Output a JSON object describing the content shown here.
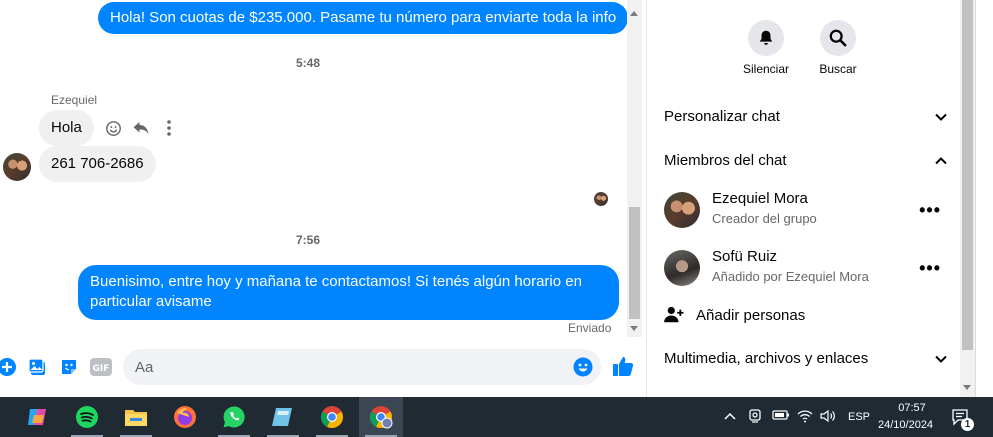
{
  "chat": {
    "top_message": "Hola! Son cuotas de $235.000. Pasame tu número para enviarte toda la info",
    "time_1": "5:48",
    "sender_name": "Ezequiel",
    "incoming": [
      "Hola",
      "261 706-2686"
    ],
    "time_2": "7:56",
    "outgoing": "Buenisimo, entre hoy y mañana te contactamos! Si tenés algún horario en particular avisame",
    "status": "Enviado"
  },
  "composer": {
    "placeholder": "Aa"
  },
  "info_panel": {
    "mute_label": "Silenciar",
    "search_label": "Buscar",
    "customize_chat": "Personalizar chat",
    "chat_members": "Miembros del chat",
    "members": [
      {
        "name": "Ezequiel Mora",
        "sub": "Creador del grupo"
      },
      {
        "name": "Sofü Ruiz",
        "sub": "Añadido por Ezequiel Mora"
      }
    ],
    "add_people": "Añadir personas",
    "media_files_links": "Multimedia, archivos y enlaces"
  },
  "taskbar": {
    "language": "ESP",
    "time": "07:57",
    "date": "24/10/2024",
    "notification_count": "1"
  },
  "colors": {
    "messenger_blue": "#0084ff",
    "taskbar_bg": "#1f2a33"
  }
}
